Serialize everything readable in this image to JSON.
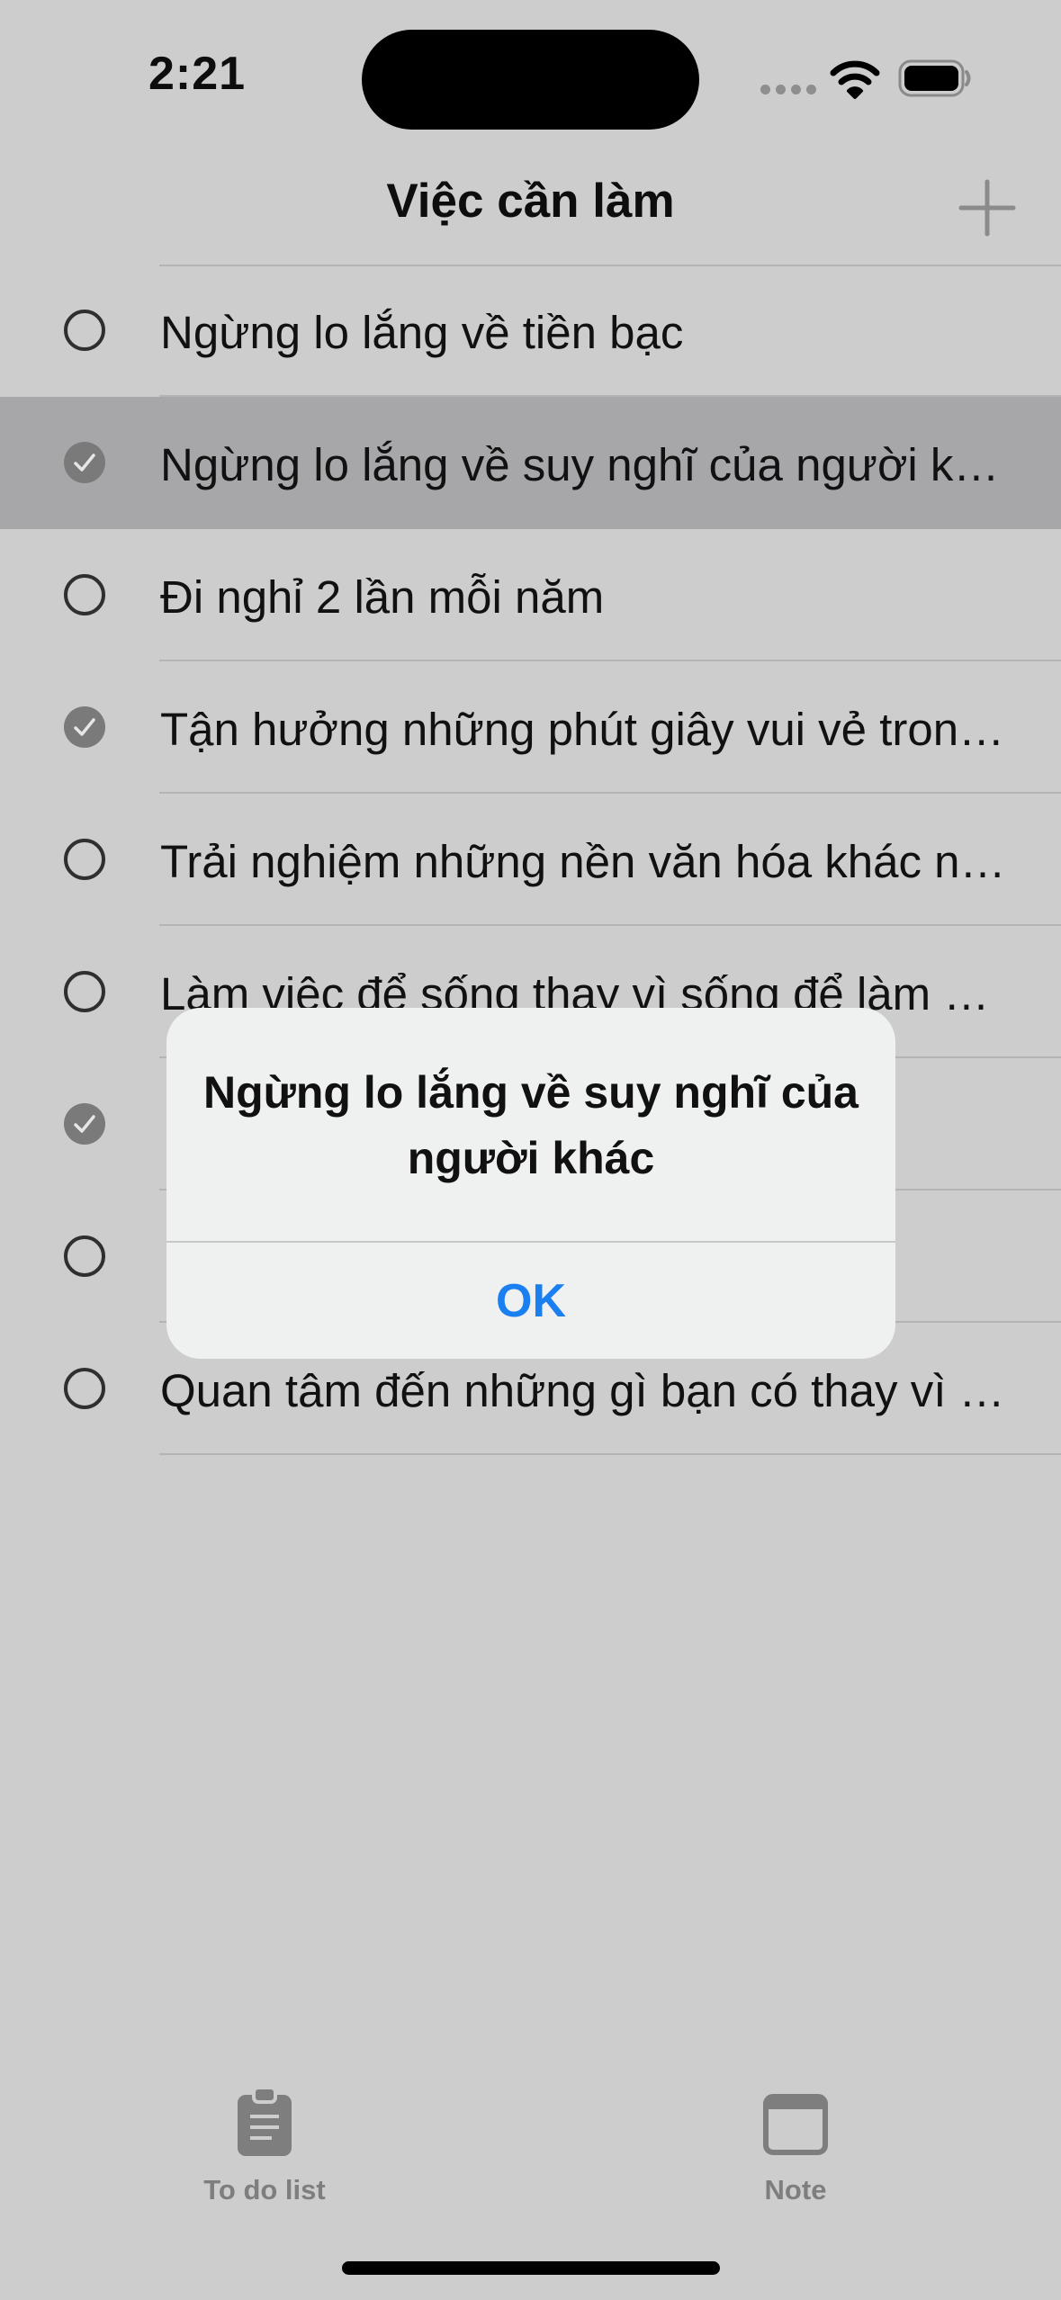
{
  "status_bar": {
    "time": "2:21"
  },
  "nav": {
    "title": "Việc cần làm",
    "add_icon": "plus-icon"
  },
  "tasks": [
    {
      "label": "Ngừng lo lắng về tiền bạc",
      "done": false
    },
    {
      "label": "Ngừng lo lắng về suy nghĩ của người khác",
      "done": true,
      "selected": true
    },
    {
      "label": "Đi nghỉ 2 lần mỗi năm",
      "done": false
    },
    {
      "label": "Tận hưởng những phút giây vui vẻ trong cuộc sống",
      "done": true
    },
    {
      "label": "Trải nghiệm những nền văn hóa khác nhau",
      "done": false
    },
    {
      "label": "Làm việc để sống thay vì sống để làm việc",
      "done": false
    },
    {
      "label": "",
      "done": true
    },
    {
      "label": "",
      "done": false
    },
    {
      "label": "Quan tâm đến những gì bạn có thay vì những gì bạn không có",
      "done": false
    }
  ],
  "alert": {
    "title": "Ngừng lo lắng về suy nghĩ của người khác",
    "ok_label": "OK"
  },
  "tab_bar": {
    "tabs": [
      {
        "label": "To do list",
        "icon": "clipboard-icon"
      },
      {
        "label": "Note",
        "icon": "window-icon"
      }
    ]
  },
  "colors": {
    "background": "#cdcdcd",
    "selected_row": "#a7a7aa",
    "alert_background": "#eff0f0",
    "accent": "#1a7ff0",
    "tab_inactive": "#7e7e7e"
  }
}
